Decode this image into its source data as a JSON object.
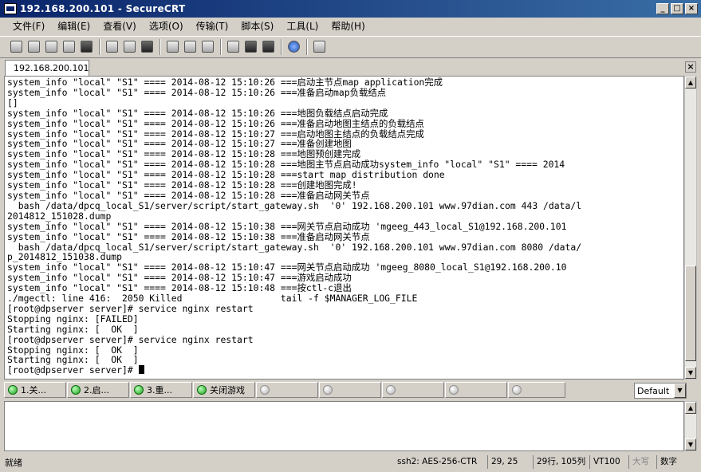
{
  "window": {
    "title": "192.168.200.101 - SecureCRT"
  },
  "menu": [
    "文件(F)",
    "编辑(E)",
    "查看(V)",
    "选项(O)",
    "传输(T)",
    "脚本(S)",
    "工具(L)",
    "帮助(H)"
  ],
  "toolbar": {
    "icons": [
      "connect-icon",
      "quick-connect-icon",
      "connect-tab-icon",
      "reconnect-icon",
      "disconnect-icon",
      "copy-icon",
      "paste-icon",
      "find-icon",
      "print-icon",
      "print-selection-icon",
      "print-preview-icon",
      "session-options-icon",
      "global-options-icon",
      "keymap-icon",
      "help-icon",
      "screen-icon"
    ]
  },
  "tab": {
    "label": "192.168.200.101"
  },
  "terminal": {
    "lines": [
      "system_info \"local\" \"S1\" ==== 2014-08-12 15:10:26 ===启动主节点map application完成",
      "system_info \"local\" \"S1\" ==== 2014-08-12 15:10:26 ===准备启动map负载结点",
      "[]",
      "system_info \"local\" \"S1\" ==== 2014-08-12 15:10:26 ===地图负载结点启动完成",
      "system_info \"local\" \"S1\" ==== 2014-08-12 15:10:26 ===准备启动地图主结点的负载结点",
      "system_info \"local\" \"S1\" ==== 2014-08-12 15:10:27 ===启动地图主结点的负载结点完成",
      "system_info \"local\" \"S1\" ==== 2014-08-12 15:10:27 ===准备创建地图",
      "system_info \"local\" \"S1\" ==== 2014-08-12 15:10:28 ===地图预创建完成",
      "system_info \"local\" \"S1\" ==== 2014-08-12 15:10:28 ===地图主节点启动成功system_info \"local\" \"S1\" ==== 2014",
      "system_info \"local\" \"S1\" ==== 2014-08-12 15:10:28 ===start map distribution done",
      "system_info \"local\" \"S1\" ==== 2014-08-12 15:10:28 ===创建地图完成!",
      "system_info \"local\" \"S1\" ==== 2014-08-12 15:10:28 ===准备启动网关节点",
      "  bash /data/dpcq_local_S1/server/script/start_gateway.sh  '0' 192.168.200.101 www.97dian.com 443 /data/l",
      "2014812_151028.dump",
      "system_info \"local\" \"S1\" ==== 2014-08-12 15:10:38 ===网关节点启动成功 'mgeeg_443_local_S1@192.168.200.101",
      "system_info \"local\" \"S1\" ==== 2014-08-12 15:10:38 ===准备启动网关节点",
      "  bash /data/dpcq_local_S1/server/script/start_gateway.sh  '0' 192.168.200.101 www.97dian.com 8080 /data/",
      "p_2014812_151038.dump",
      "system_info \"local\" \"S1\" ==== 2014-08-12 15:10:47 ===网关节点启动成功 'mgeeg_8080_local_S1@192.168.200.10",
      "system_info \"local\" \"S1\" ==== 2014-08-12 15:10:47 ===游戏启动成功",
      "system_info \"local\" \"S1\" ==== 2014-08-12 15:10:48 ===按ctl-c退出",
      "./mgectl: line 416:  2050 Killed                  tail -f $MANAGER_LOG_FILE",
      "[root@dpserver server]# service nginx restart",
      "Stopping nginx: [FAILED]",
      "Starting nginx: [  OK  ]",
      "[root@dpserver server]# service nginx restart",
      "Stopping nginx: [  OK  ]",
      "Starting nginx: [  OK  ]"
    ],
    "prompt": "[root@dpserver server]# ",
    "scroll_position": 0.97
  },
  "button_bar": {
    "buttons": [
      "1.关...",
      "2.启...",
      "3.重...",
      "关闭游戏"
    ],
    "session": "Default"
  },
  "status": {
    "ready": "就绪",
    "cipher": "ssh2: AES-256-CTR",
    "cursor": "29,  25",
    "size": "29行, 105列",
    "terminal_type": "VT100",
    "caps": "大写",
    "num": "数字"
  }
}
